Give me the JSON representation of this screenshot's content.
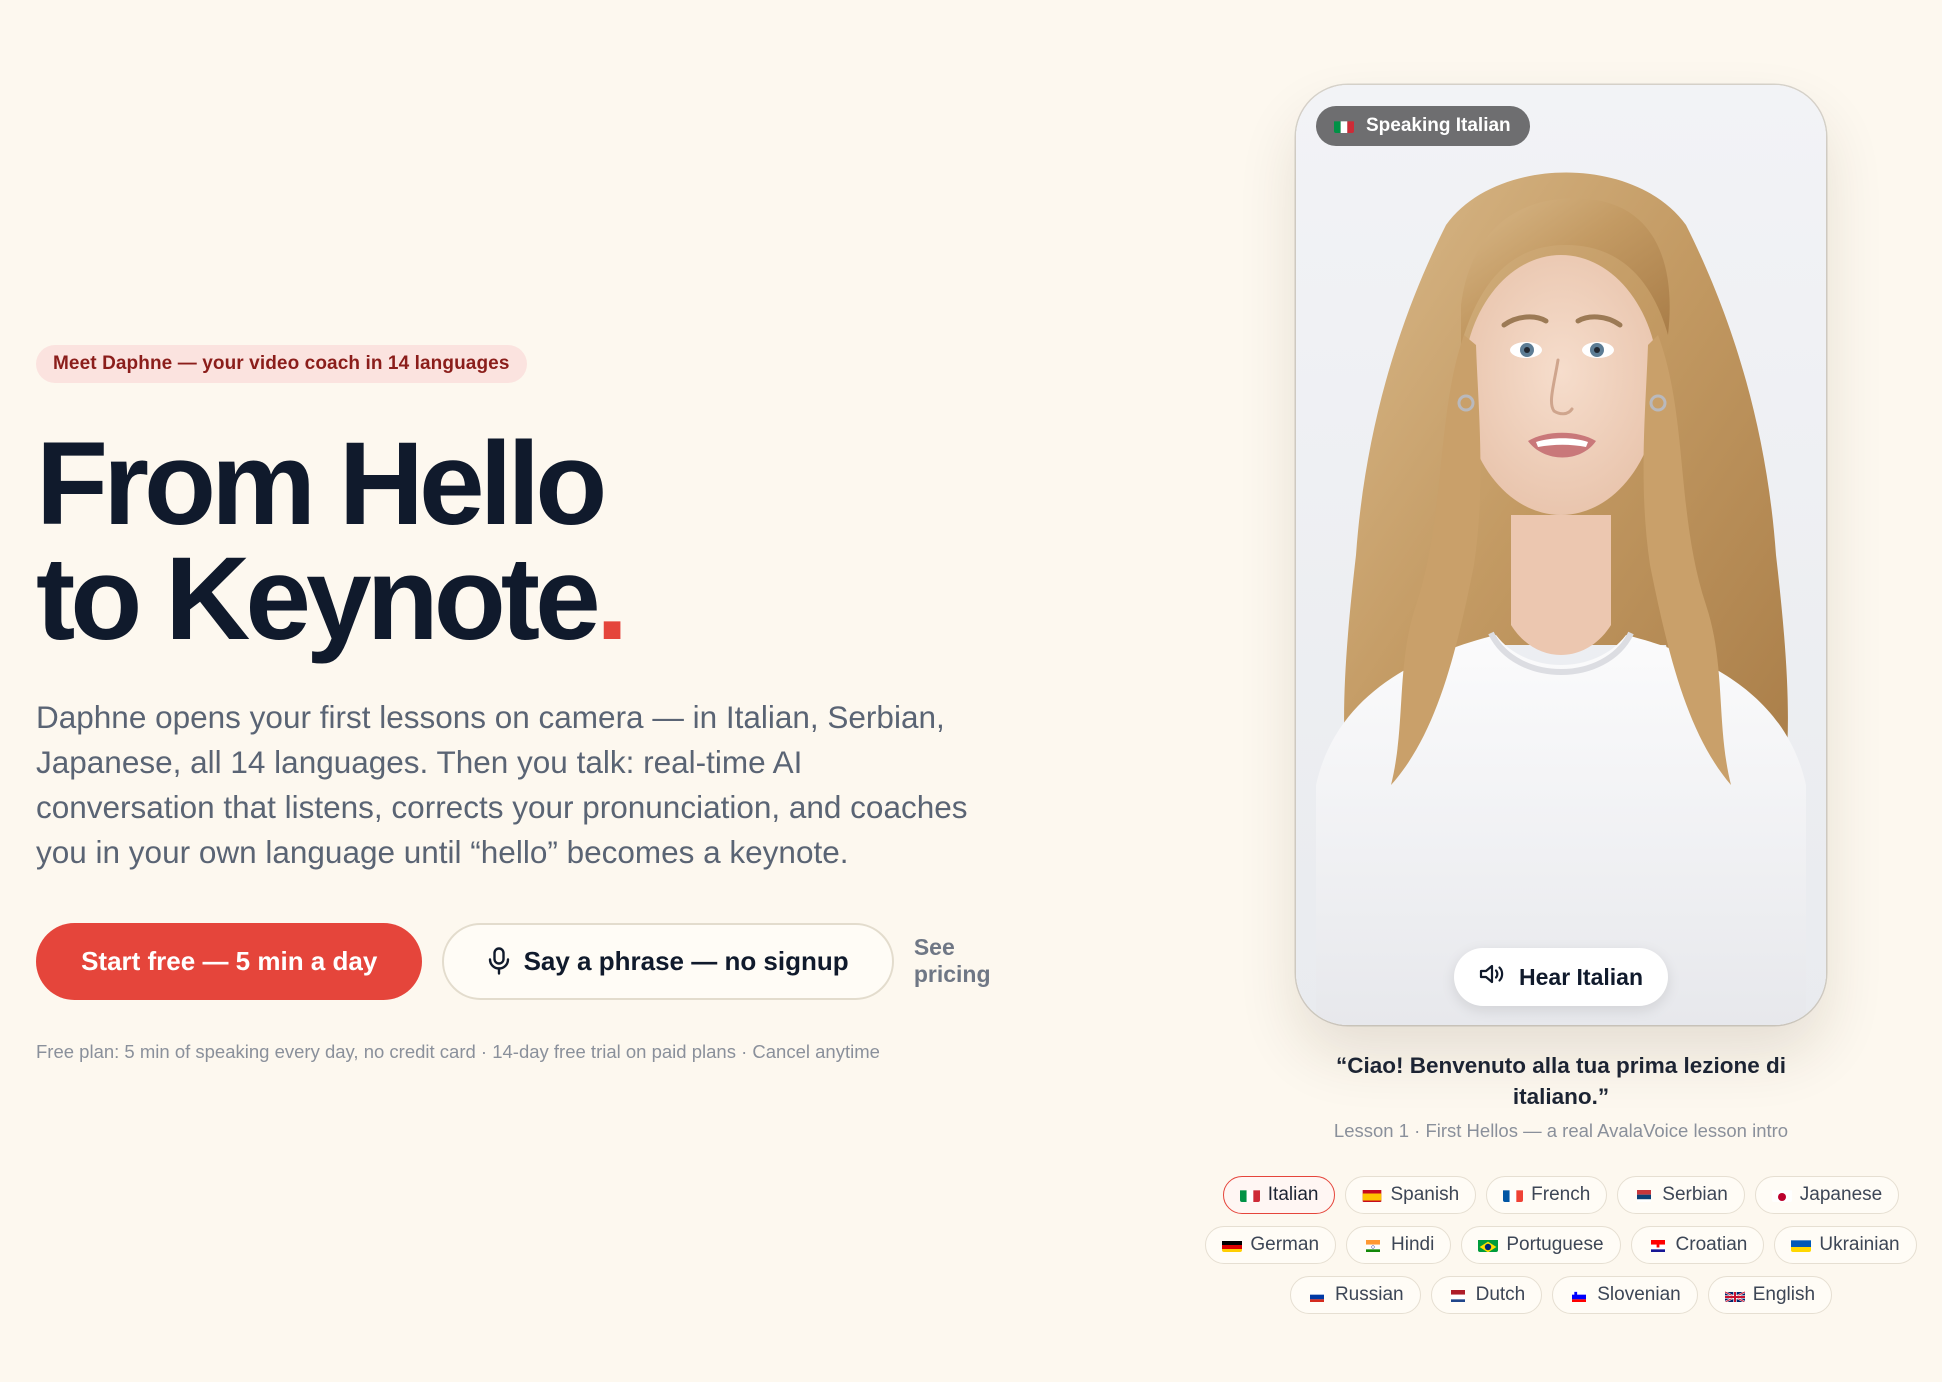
{
  "hero": {
    "badge": "Meet Daphne — your video coach in 14 languages",
    "headline_line1": "From Hello",
    "headline_line2": "to Keynote",
    "headline_dot": ".",
    "lede": "Daphne opens your first lessons on camera — in Italian, Serbian, Japanese, all 14 languages. Then you talk: real-time AI conversation that listens, corrects your pronunciation, and coaches you in your own language until “hello” becomes a keynote.",
    "primary_cta": "Start free — 5 min a day",
    "secondary_cta": "Say a phrase — no signup",
    "pricing_link": "See pricing",
    "fineprint": "Free plan: 5 min of speaking every day, no credit card · 14-day free trial on paid plans · Cancel anytime"
  },
  "video": {
    "speaking_label": "Speaking Italian",
    "speaking_flag": "it",
    "hear_button": "Hear Italian",
    "quote": "“Ciao! Benvenuto alla tua prima lezione di italiano.”",
    "caption": "Lesson 1 · First Hellos — a real AvalaVoice lesson intro"
  },
  "languages": [
    {
      "label": "Italian",
      "flag": "it",
      "active": true
    },
    {
      "label": "Spanish",
      "flag": "es",
      "active": false
    },
    {
      "label": "French",
      "flag": "fr",
      "active": false
    },
    {
      "label": "Serbian",
      "flag": "rs",
      "active": false
    },
    {
      "label": "Japanese",
      "flag": "jp",
      "active": false
    },
    {
      "label": "German",
      "flag": "de",
      "active": false
    },
    {
      "label": "Hindi",
      "flag": "in",
      "active": false
    },
    {
      "label": "Portuguese",
      "flag": "br",
      "active": false
    },
    {
      "label": "Croatian",
      "flag": "hr",
      "active": false
    },
    {
      "label": "Ukrainian",
      "flag": "ua",
      "active": false
    },
    {
      "label": "Russian",
      "flag": "ru",
      "active": false
    },
    {
      "label": "Dutch",
      "flag": "nl",
      "active": false
    },
    {
      "label": "Slovenian",
      "flag": "si",
      "active": false
    },
    {
      "label": "English",
      "flag": "gb",
      "active": false
    }
  ],
  "colors": {
    "background": "#fdf8ef",
    "accent": "#e5453b",
    "headline": "#101a2c",
    "body_text": "#5a6474",
    "badge_bg": "#fbe3df",
    "badge_text": "#8b1e1b"
  },
  "icons": {
    "secondary_cta": "microphone-icon",
    "hear_button": "speaker-icon"
  }
}
